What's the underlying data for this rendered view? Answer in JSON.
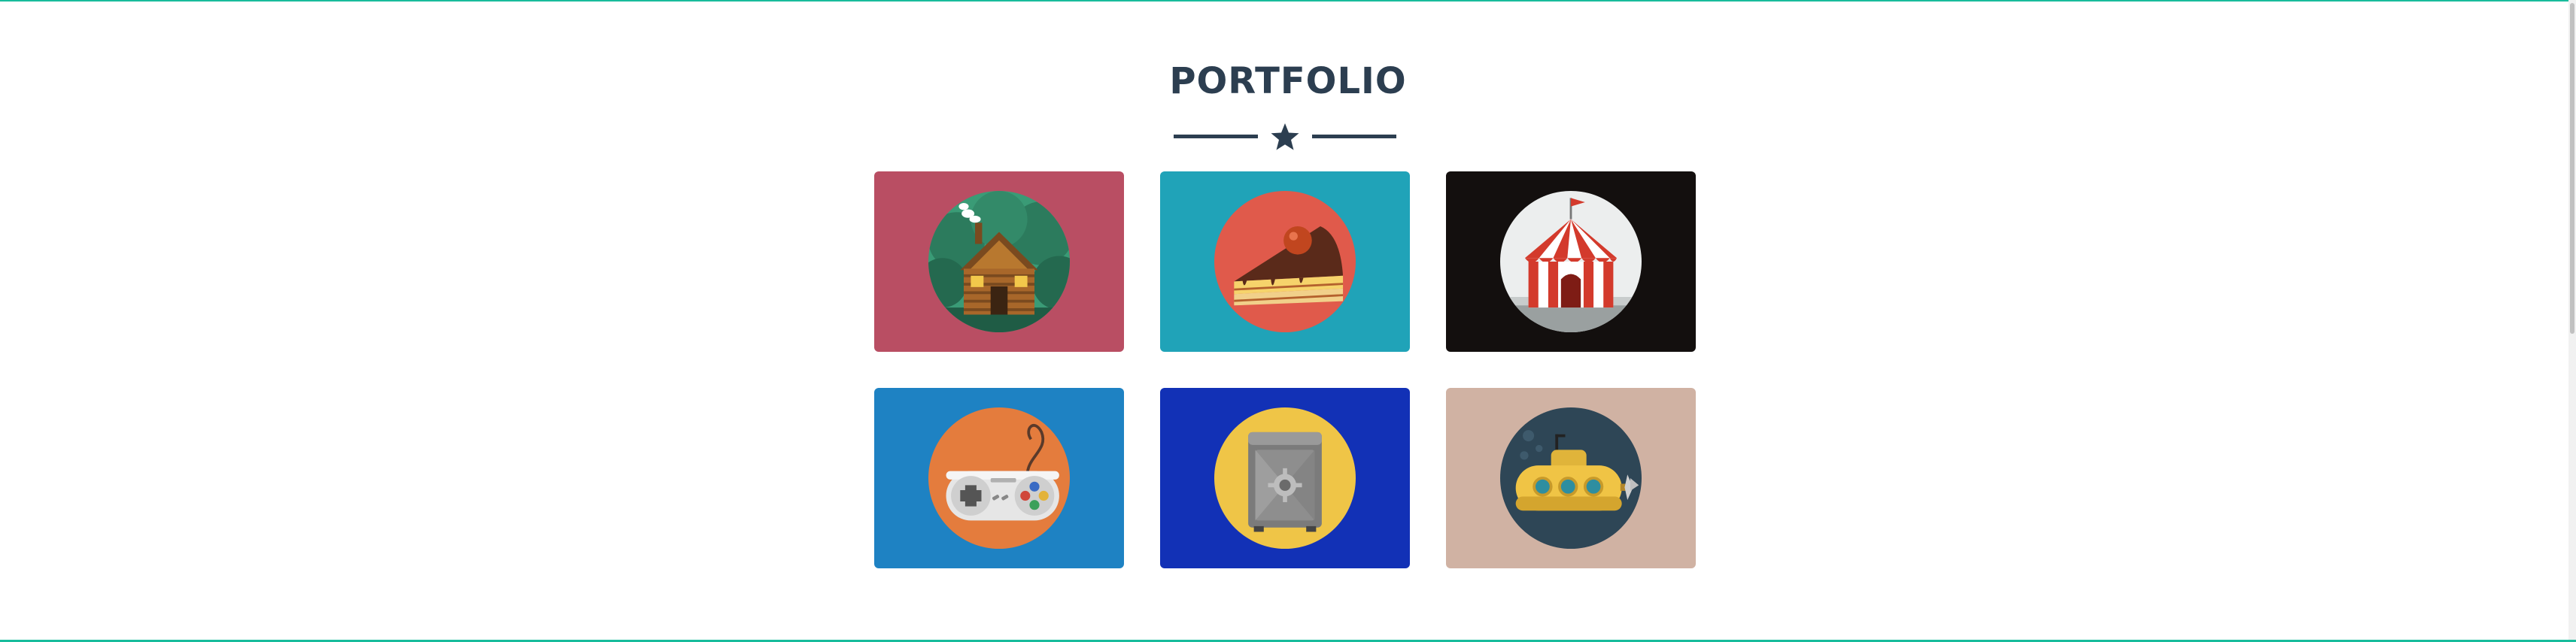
{
  "section": {
    "title": "PORTFOLIO",
    "divider_icon": "star-icon"
  },
  "portfolio": {
    "items": [
      {
        "icon": "log-cabin-icon",
        "background": "#b94e63",
        "circle": "#3a9b76"
      },
      {
        "icon": "cake-slice-icon",
        "background": "#20a3b8",
        "circle": "#e05a4b"
      },
      {
        "icon": "circus-tent-icon",
        "background": "#130f0e",
        "circle": "#eceeee"
      },
      {
        "icon": "game-controller-icon",
        "background": "#1e82c3",
        "circle": "#e47c3d"
      },
      {
        "icon": "safe-icon",
        "background": "#1231b6",
        "circle": "#efc547"
      },
      {
        "icon": "submarine-icon",
        "background": "#d0b2a3",
        "circle": "#2e4656"
      }
    ]
  },
  "colors": {
    "accent": "#18bc9c",
    "heading": "#2c3e50",
    "background": "#ffffff"
  }
}
